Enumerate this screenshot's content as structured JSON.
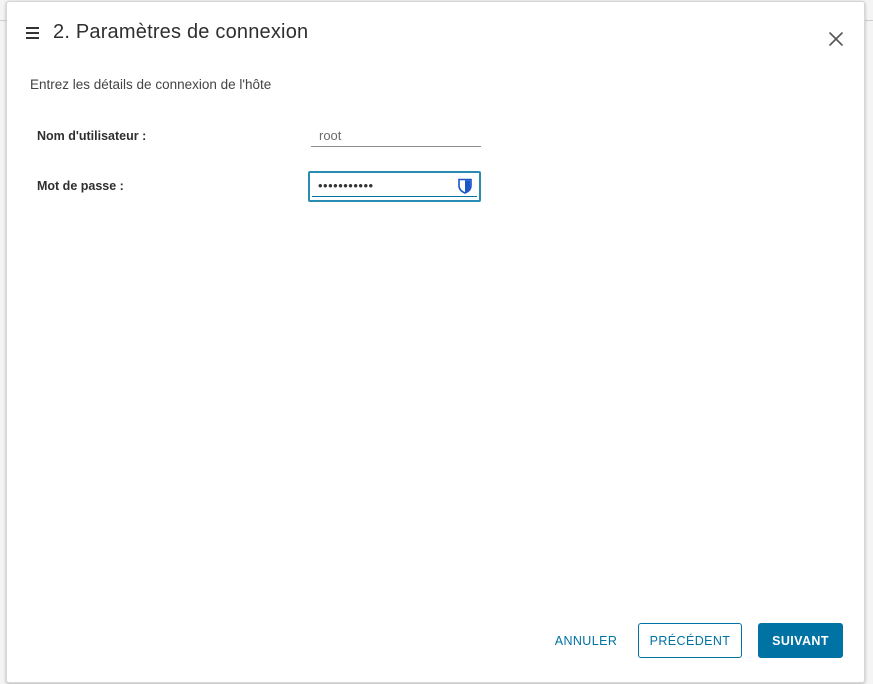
{
  "dialog": {
    "title": "2. Paramètres de connexion",
    "subtitle": "Entrez les détails de connexion de l'hôte"
  },
  "form": {
    "username_label": "Nom d'utilisateur :",
    "username_value": "root",
    "password_label": "Mot de passe :",
    "password_value": "•••••••••••"
  },
  "footer": {
    "cancel_label": "ANNULER",
    "previous_label": "PRÉCÉDENT",
    "next_label": "SUIVANT"
  },
  "icons": {
    "menu": "menu-icon",
    "close": "close-icon",
    "password_manager": "shield-icon"
  },
  "colors": {
    "accent": "#0072a3",
    "focus_border": "#2a8cb3",
    "shield": "#1a56c8"
  }
}
